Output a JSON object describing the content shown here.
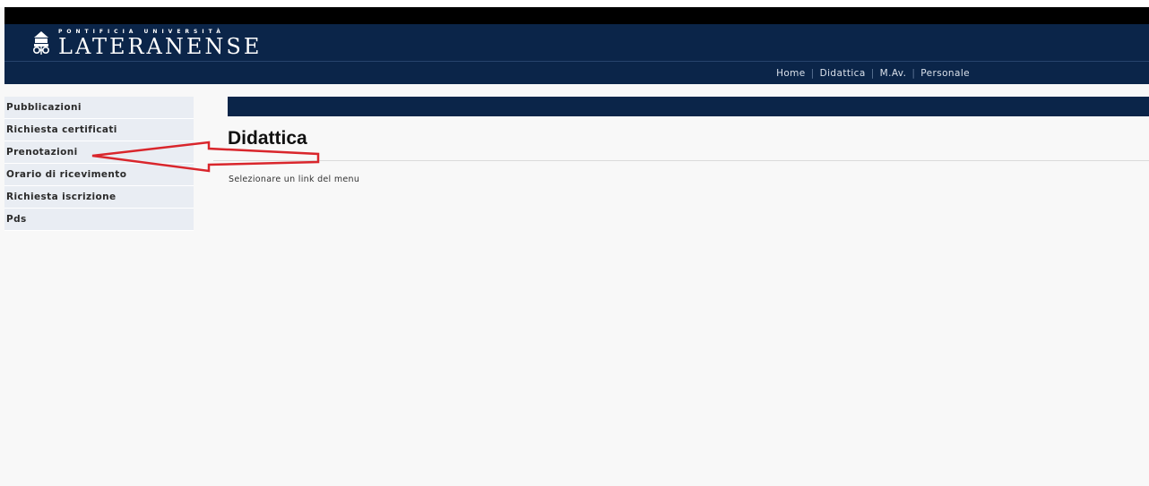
{
  "header": {
    "logo_small": "PONTIFICIA UNIVERSITÀ",
    "logo_big": "LATERANENSE"
  },
  "nav": {
    "items": [
      {
        "label": "Home"
      },
      {
        "label": "Didattica"
      },
      {
        "label": "M.Av."
      },
      {
        "label": "Personale"
      }
    ]
  },
  "sidebar": {
    "items": [
      {
        "label": "Pubblicazioni"
      },
      {
        "label": "Richiesta certificati"
      },
      {
        "label": "Prenotazioni"
      },
      {
        "label": "Orario di ricevimento"
      },
      {
        "label": "Richiesta iscrizione"
      },
      {
        "label": "Pds"
      }
    ]
  },
  "main": {
    "title": "Didattica",
    "message": "Selezionare un link del menu"
  },
  "annotation": {
    "color": "#d9262c",
    "target": "Prenotazioni"
  }
}
